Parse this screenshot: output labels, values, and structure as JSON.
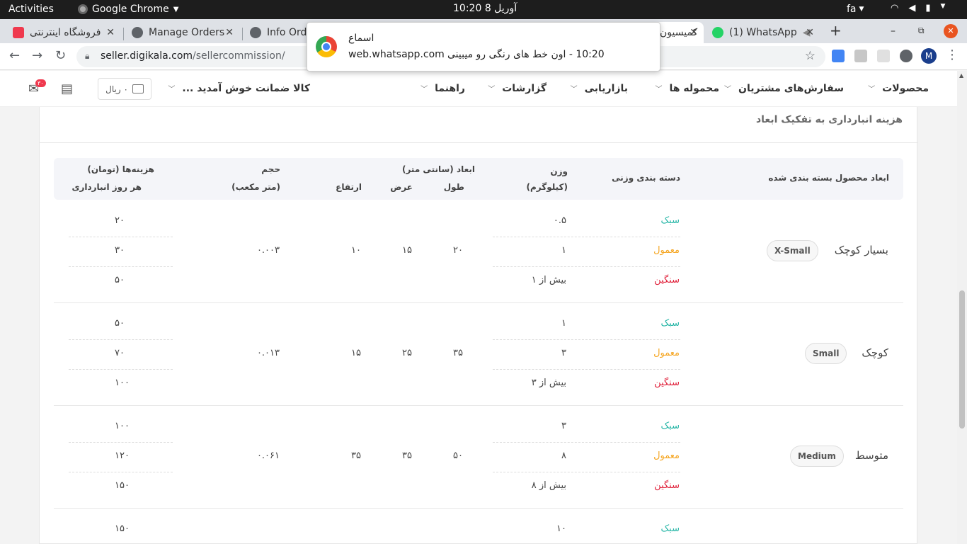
{
  "os": {
    "activities": "Activities",
    "app_name": "Google Chrome",
    "clock": "آوریل 8  10:20",
    "lang": "fa"
  },
  "tabs": [
    {
      "title": "فروشگاه اینترنتی",
      "favicon_color": "#ef394e"
    },
    {
      "title": "Manage Orders",
      "favicon_color": "#5f6368"
    },
    {
      "title": "Info Orders",
      "favicon_color": "#5f6368"
    },
    {
      "title": "کمیسیون",
      "favicon_color": "#ef394e",
      "active": true
    },
    {
      "title": "(1) WhatsApp",
      "favicon_color": "#25d366"
    }
  ],
  "address_bar": {
    "host": "seller.digikala.com",
    "path": "/sellercommission/"
  },
  "notification": {
    "title": "اسماع",
    "source": "web.whatsapp.com",
    "message": "10:20 - اون خط های رنگی رو میبینی"
  },
  "site_nav": {
    "items": [
      "محصولات",
      "سفارش‌های مشتریان",
      "محموله ها",
      "بازاریابی",
      "گزارشات",
      "راهنما"
    ],
    "promo": "کالا ضمانت خوش آمدید ...",
    "wallet": "۰ ریال",
    "badge": "۳۰"
  },
  "section": {
    "title": "هزینه انبارداری به تفکیک ابعاد"
  },
  "table": {
    "headers": {
      "dimensions": "ابعاد محصول بسته بندی شده",
      "weight_class": "دسته بندی وزنی",
      "weight": "وزن",
      "weight_unit": "(کیلوگرم)",
      "size": "ابعاد (سانتی متر)",
      "length": "طول",
      "width": "عرض",
      "height": "ارتفاع",
      "volume": "حجم",
      "volume_unit": "(متر مکعب)",
      "cost": "هزینه‌ها (تومان)",
      "cost_unit": "هر روز انبارداری"
    },
    "weight_labels": {
      "light": "سبک",
      "normal": "معمول",
      "heavy": "سنگین"
    },
    "rows": [
      {
        "name": "بسیار کوچک",
        "code": "X-Small",
        "weights": [
          "۰.۵",
          "۱",
          "بیش از ۱"
        ],
        "length": "۲۰",
        "width": "۱۵",
        "height": "۱۰",
        "volume": "۰.۰۰۳",
        "costs": [
          "۲۰",
          "۳۰",
          "۵۰"
        ]
      },
      {
        "name": "کوچک",
        "code": "Small",
        "weights": [
          "۱",
          "۳",
          "بیش از ۳"
        ],
        "length": "۳۵",
        "width": "۲۵",
        "height": "۱۵",
        "volume": "۰.۰۱۳",
        "costs": [
          "۵۰",
          "۷۰",
          "۱۰۰"
        ]
      },
      {
        "name": "متوسط",
        "code": "Medium",
        "weights": [
          "۳",
          "۸",
          "بیش از ۸"
        ],
        "length": "۵۰",
        "width": "۳۵",
        "height": "۳۵",
        "volume": "۰.۰۶۱",
        "costs": [
          "۱۰۰",
          "۱۲۰",
          "۱۵۰"
        ]
      },
      {
        "name": "",
        "code": "",
        "weights": [
          "۱۰"
        ],
        "costs": [
          "۱۵۰"
        ]
      }
    ]
  }
}
